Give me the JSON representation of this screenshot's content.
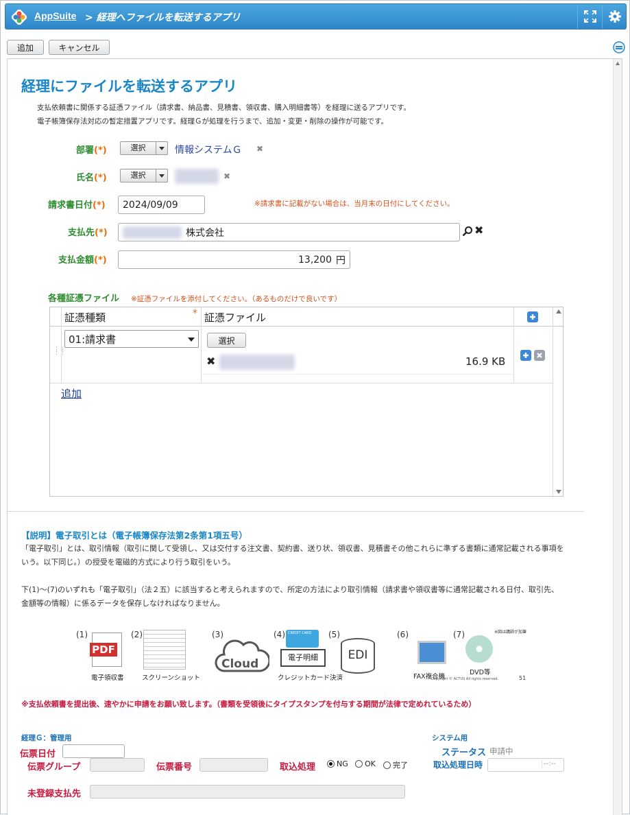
{
  "header": {
    "app_name": "AppSuite",
    "breadcrumb": "> 経理へファイルを転送するアプリ"
  },
  "toolbar": {
    "add_label": "追加",
    "cancel_label": "キャンセル"
  },
  "form": {
    "title": "経理にファイルを転送するアプリ",
    "desc_line1": "支払依頼書に関係する証憑ファイル（請求書、納品書、見積書、領収書、購入明細書等）を経理に送るアプリです。",
    "desc_line2": "電子帳簿保存法対応の暫定措置アプリです。経理Ｇが処理を行うまで、追加・変更・削除の操作が可能です。",
    "req_mark": "(*)",
    "select_label": "選択",
    "dept_label": "部署",
    "dept_value": "情報システムＧ",
    "name_label": "氏名",
    "invoice_date_label": "請求書日付",
    "invoice_date_value": "2024/09/09",
    "invoice_date_note": "※請求書に記載がない場合は、当月末の日付にしてください。",
    "payee_label": "支払先",
    "payee_value": "株式会社",
    "amount_label": "支払金額",
    "amount_value": "13,200",
    "amount_unit": "円",
    "files_label": "各種証憑ファイル",
    "files_note": "※証憑ファイルを添付してください。（あるものだけで良いです）"
  },
  "table": {
    "col1_header": "証憑種類",
    "col1_req": "*",
    "col2_header": "証憑ファイル",
    "rows": [
      {
        "type_value": "01:請求書",
        "select_label": "選択",
        "file_size": "16.9 KB"
      }
    ],
    "add_link": "追加"
  },
  "explain": {
    "title": "【説明】電子取引とは（電子帳簿保存法第2条第1項五号）",
    "p1_line1": "「電子取引」とは、取引情報（取引に関して受領し、又は交付する注文書、契約書、送り状、領収書、見積書その他これらに準ずる書類に通常記載される事項を",
    "p1_line2": "いう。以下同じ。）の授受を電磁的方式により行う取引をいう。",
    "p2_line1": "下(1)～(7)のいずれも「電子取引」（法２五）に該当すると考えられますので、所定の方法により取引情報（請求書や領収書等に通常記載される日付、取引先、",
    "p2_line2": "金額等の情報）に係るデータを保存しなければなりません。",
    "banner": {
      "items": [
        {
          "num": "(1)",
          "label": "電子領収書",
          "icon": "pdf-icon",
          "icon_text": "PDF"
        },
        {
          "num": "(2)",
          "label": "スクリーンショット",
          "icon": "screenshot-icon"
        },
        {
          "num": "(3)",
          "label": "",
          "icon": "cloud-icon",
          "icon_text": "Cloud"
        },
        {
          "num": "(4)",
          "label": "クレジットカード決済",
          "icon": "credit-card-icon",
          "icon_text": "電子明細",
          "card_text": "CREDIT CARD"
        },
        {
          "num": "(5)",
          "label": "",
          "icon": "edi-icon",
          "icon_text": "EDI"
        },
        {
          "num": "(6)",
          "label": "FAX複合機",
          "icon": "fax-icon"
        },
        {
          "num": "(7)",
          "label": "DVD等",
          "icon": "dvd-icon"
        }
      ],
      "note": "※図は講師が加筆",
      "copyright": "Copyright © ACTUS  All rights reserved.",
      "page": "51"
    }
  },
  "warning": "※支払依頼書を提出後、速やかに申請をお願い致します。（書類を受領後にタイプスタンプを付与する期間が法律で定めれているため）",
  "accounting": {
    "section_label": "経理Ｇ：管理用",
    "slip_date_label": "伝票日付",
    "slip_group_label": "伝票グループ",
    "slip_no_label": "伝票番号",
    "import_label": "取込処理",
    "radio_options": [
      "NG",
      "OK",
      "完了"
    ],
    "selected": "NG",
    "unregistered_label": "未登録支払先"
  },
  "system": {
    "section_label": "システム用",
    "status_label": "ステータス",
    "status_value": "申請中",
    "import_date_label": "取込処理日時",
    "import_time_placeholder": "--:--"
  },
  "colors": {
    "accent": "#1a86c8",
    "required": "#e8700c",
    "label_green": "#2e8b2e",
    "note_red": "#d2501a",
    "magenta": "#c8193e"
  }
}
